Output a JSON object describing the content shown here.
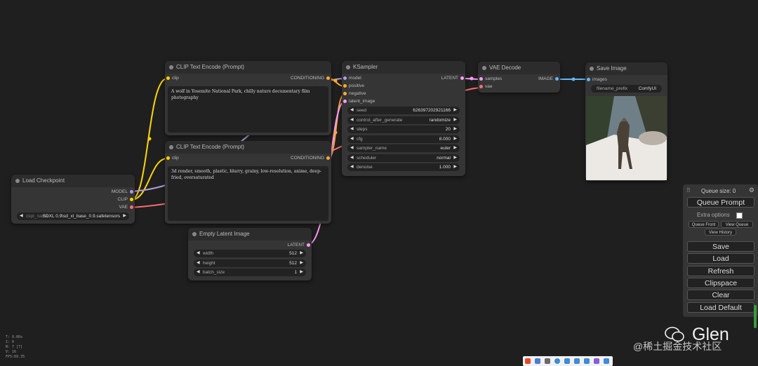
{
  "nodes": {
    "clip_pos": {
      "title": "CLIP Text Encode (Prompt)",
      "input_clip": "clip",
      "output": "CONDITIONING",
      "text": "A wolf in Yosemite National Park, chilly nature documentary film photography"
    },
    "clip_neg": {
      "title": "CLIP Text Encode (Prompt)",
      "input_clip": "clip",
      "output": "CONDITIONING",
      "text": "3d render, smooth, plastic, blurry, grainy, low-resolution, anime, deep-fried, oversaturated"
    },
    "checkpoint": {
      "title": "Load Checkpoint",
      "out_model": "MODEL",
      "out_clip": "CLIP",
      "out_vae": "VAE",
      "ckpt_label": "ckpt_name",
      "ckpt_value": "SDXL 0.9\\sd_xl_base_0.9.safetensors"
    },
    "ksampler": {
      "title": "KSampler",
      "in_model": "model",
      "in_positive": "positive",
      "in_negative": "negative",
      "in_latent": "latent_image",
      "output": "LATENT",
      "widgets": [
        {
          "label": "seed",
          "value": "626397202921166"
        },
        {
          "label": "control_after_generate",
          "value": "randomize"
        },
        {
          "label": "steps",
          "value": "20"
        },
        {
          "label": "cfg",
          "value": "8.000"
        },
        {
          "label": "sampler_name",
          "value": "euler"
        },
        {
          "label": "scheduler",
          "value": "normal"
        },
        {
          "label": "denoise",
          "value": "1.000"
        }
      ]
    },
    "vae_decode": {
      "title": "VAE Decode",
      "in_samples": "samples",
      "in_vae": "vae",
      "output": "IMAGE"
    },
    "save_image": {
      "title": "Save Image",
      "in_images": "images",
      "prefix_label": "filename_prefix",
      "prefix_value": "ComfyUI"
    },
    "empty_latent": {
      "title": "Empty Latent Image",
      "output": "LATENT",
      "widgets": [
        {
          "label": "width",
          "value": "512"
        },
        {
          "label": "height",
          "value": "512"
        },
        {
          "label": "batch_size",
          "value": "1"
        }
      ]
    }
  },
  "panel": {
    "queue_size": "Queue size: 0",
    "queue_prompt": "Queue Prompt",
    "extra_options": "Extra options",
    "queue_front": "Queue Front",
    "view_queue": "View Queue",
    "view_history": "View History",
    "save": "Save",
    "load": "Load",
    "refresh": "Refresh",
    "clipspace": "Clipspace",
    "clear": "Clear",
    "load_default": "Load Default"
  },
  "stats": {
    "t": "T: 0.00s",
    "i": "I: 0",
    "n": "N: 7 [7]",
    "v": "V: 16",
    "fps": "FPS:69.35"
  },
  "watermark": {
    "name": "Glen",
    "site": "@稀土掘金技术社区"
  },
  "colors": {
    "clip": "#ffd500",
    "model": "#b39ddb",
    "vae": "#ff6e6e",
    "conditioning": "#ffa931",
    "latent": "#ff9cf9",
    "image": "#64b5f6"
  }
}
